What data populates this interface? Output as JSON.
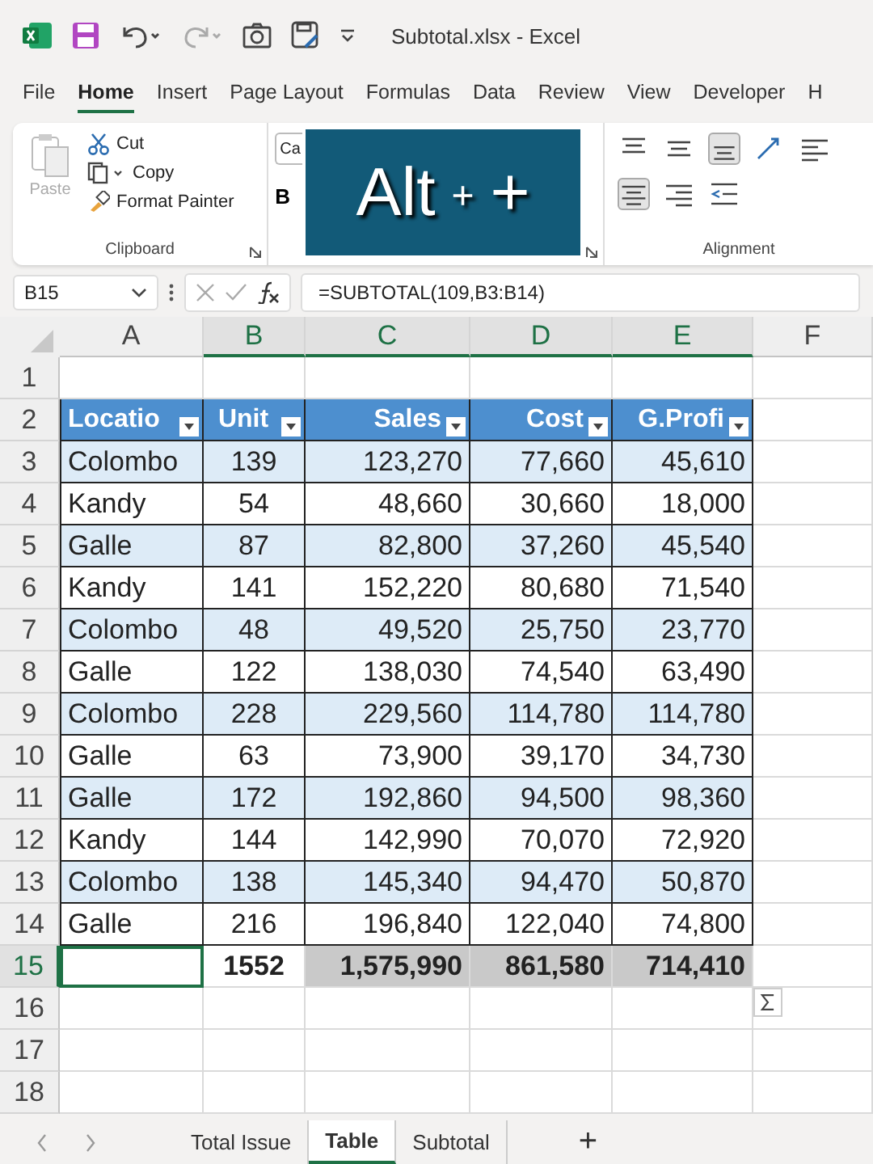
{
  "title_bar": {
    "title": "Subtotal.xlsx  -  Excel"
  },
  "menu_tabs": [
    {
      "label": "File",
      "selected": false
    },
    {
      "label": "Home",
      "selected": true
    },
    {
      "label": "Insert",
      "selected": false
    },
    {
      "label": "Page Layout",
      "selected": false
    },
    {
      "label": "Formulas",
      "selected": false
    },
    {
      "label": "Data",
      "selected": false
    },
    {
      "label": "Review",
      "selected": false
    },
    {
      "label": "View",
      "selected": false
    },
    {
      "label": "Developer",
      "selected": false
    },
    {
      "label": "H",
      "selected": false
    }
  ],
  "ribbon": {
    "clipboard": {
      "paste": "Paste",
      "cut": "Cut",
      "copy": "Copy",
      "format_painter": "Format Painter",
      "label": "Clipboard"
    },
    "font": {
      "font_field": "Ca",
      "bold": "B"
    },
    "alignment": {
      "label": "Alignment"
    }
  },
  "overlay": {
    "parts": [
      {
        "text": "Alt",
        "kind": "key"
      },
      {
        "text": "+",
        "kind": "joiner"
      },
      {
        "text": "+",
        "kind": "key"
      }
    ]
  },
  "formula_bar": {
    "name_box": "B15",
    "formula": "=SUBTOTAL(109,B3:B14)"
  },
  "columns": [
    {
      "label": "A",
      "selected": false
    },
    {
      "label": "B",
      "selected": true
    },
    {
      "label": "C",
      "selected": true
    },
    {
      "label": "D",
      "selected": true
    },
    {
      "label": "E",
      "selected": true
    },
    {
      "label": "F",
      "selected": false
    }
  ],
  "row_headers": [
    {
      "label": "1",
      "selected": false
    },
    {
      "label": "2",
      "selected": false
    },
    {
      "label": "3",
      "selected": false
    },
    {
      "label": "4",
      "selected": false
    },
    {
      "label": "5",
      "selected": false
    },
    {
      "label": "6",
      "selected": false
    },
    {
      "label": "7",
      "selected": false
    },
    {
      "label": "8",
      "selected": false
    },
    {
      "label": "9",
      "selected": false
    },
    {
      "label": "10",
      "selected": false
    },
    {
      "label": "11",
      "selected": false
    },
    {
      "label": "12",
      "selected": false
    },
    {
      "label": "13",
      "selected": false
    },
    {
      "label": "14",
      "selected": false
    },
    {
      "label": "15",
      "selected": true
    },
    {
      "label": "16",
      "selected": false
    },
    {
      "label": "17",
      "selected": false
    },
    {
      "label": "18",
      "selected": false
    }
  ],
  "table": {
    "headers": [
      "Locatio",
      "Unit",
      "Sales",
      "Cost",
      "G.Profi"
    ],
    "rows": [
      [
        "Colombo",
        "139",
        "123,270",
        "77,660",
        "45,610"
      ],
      [
        "Kandy",
        "54",
        "48,660",
        "30,660",
        "18,000"
      ],
      [
        "Galle",
        "87",
        "82,800",
        "37,260",
        "45,540"
      ],
      [
        "Kandy",
        "141",
        "152,220",
        "80,680",
        "71,540"
      ],
      [
        "Colombo",
        "48",
        "49,520",
        "25,750",
        "23,770"
      ],
      [
        "Galle",
        "122",
        "138,030",
        "74,540",
        "63,490"
      ],
      [
        "Colombo",
        "228",
        "229,560",
        "114,780",
        "114,780"
      ],
      [
        "Galle",
        "63",
        "73,900",
        "39,170",
        "34,730"
      ],
      [
        "Galle",
        "172",
        "192,860",
        "94,500",
        "98,360"
      ],
      [
        "Kandy",
        "144",
        "142,990",
        "70,070",
        "72,920"
      ],
      [
        "Colombo",
        "138",
        "145,340",
        "94,470",
        "50,870"
      ],
      [
        "Galle",
        "216",
        "196,840",
        "122,040",
        "74,800"
      ]
    ],
    "total": [
      {
        "text": "1552",
        "selected": false
      },
      {
        "text": "1,575,990",
        "selected": true
      },
      {
        "text": "861,580",
        "selected": true
      },
      {
        "text": "714,410",
        "selected": true
      }
    ]
  },
  "sheet_tabs": [
    {
      "label": "Total Issue",
      "selected": false
    },
    {
      "label": "Table",
      "selected": true
    },
    {
      "label": "Subtotal",
      "selected": false
    }
  ],
  "add_sheet": "+"
}
